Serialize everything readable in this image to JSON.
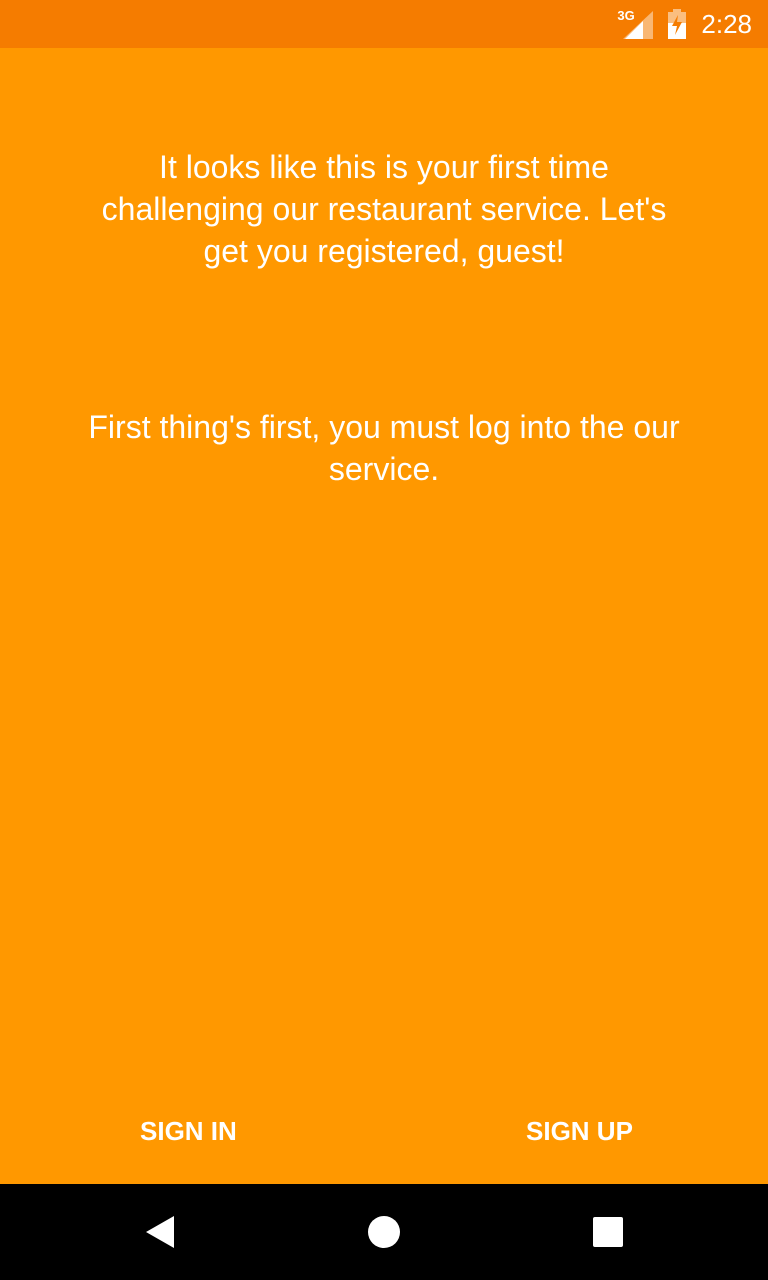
{
  "status_bar": {
    "network_type": "3G",
    "time": "2:28",
    "icons": [
      "signal-icon",
      "battery-charging-icon"
    ],
    "background_color": "#F57C00"
  },
  "main": {
    "background_color": "#FF9800",
    "welcome_message": "It looks like this is your first time challenging our restaurant service. Let's get you registered, guest!",
    "login_prompt": "First thing's first, you must log into the our service."
  },
  "actions": {
    "sign_in_label": "SIGN IN",
    "sign_up_label": "SIGN UP"
  },
  "nav_bar": {
    "buttons": [
      "back-icon",
      "home-icon",
      "recents-icon"
    ]
  }
}
